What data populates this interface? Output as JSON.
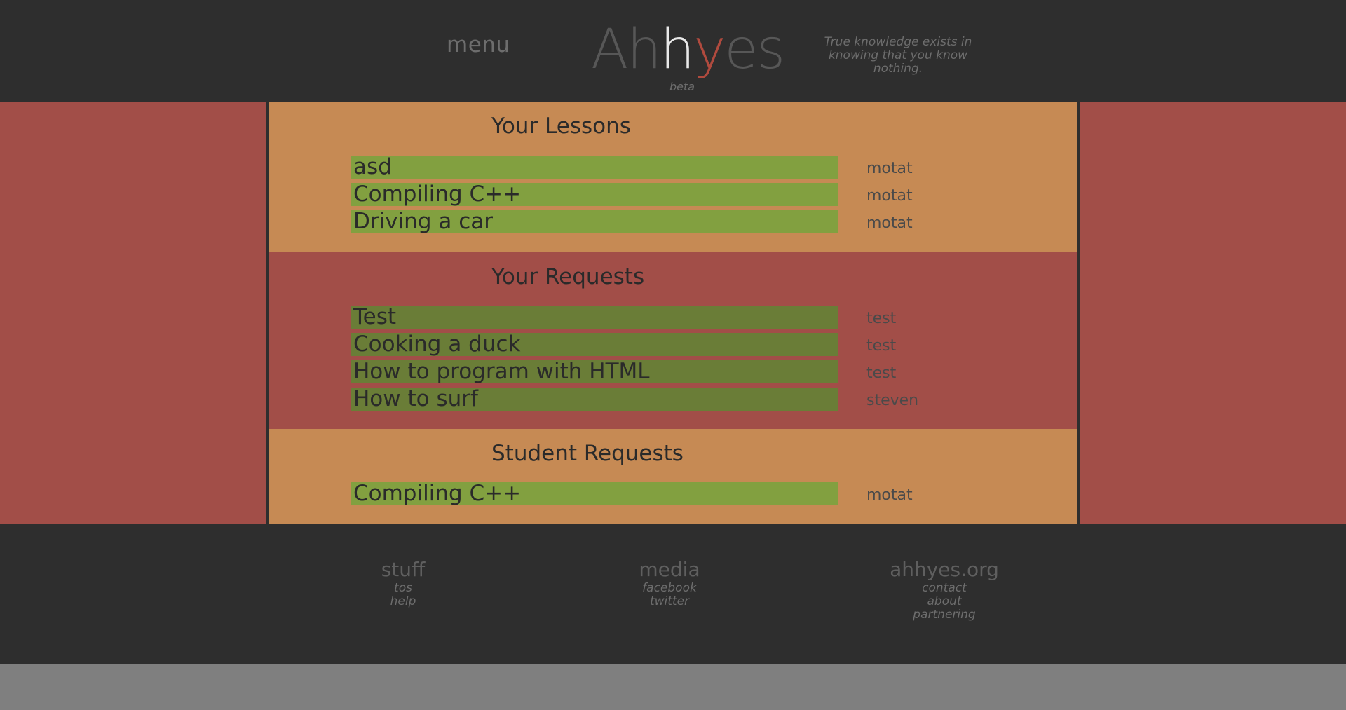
{
  "header": {
    "menu_label": "menu",
    "logo": {
      "part1": "Ah",
      "part2": "h",
      "part3": "y",
      "part4": "es"
    },
    "logo_sub": "beta",
    "quote": "True knowledge exists in knowing that you know nothing."
  },
  "sections": {
    "lessons": {
      "title": "Your Lessons",
      "items": [
        {
          "title": "asd",
          "author": "motat"
        },
        {
          "title": "Compiling C++",
          "author": "motat"
        },
        {
          "title": "Driving a car",
          "author": "motat"
        }
      ]
    },
    "requests": {
      "title": "Your Requests",
      "items": [
        {
          "title": "Test",
          "author": "test"
        },
        {
          "title": "Cooking a duck",
          "author": "test"
        },
        {
          "title": "How to program with HTML",
          "author": "test"
        },
        {
          "title": "How to surf",
          "author": "steven"
        }
      ]
    },
    "student_requests": {
      "title": "Student Requests",
      "items": [
        {
          "title": "Compiling C++",
          "author": "motat"
        }
      ]
    }
  },
  "footer": {
    "stuff": {
      "heading": "stuff",
      "links": [
        "tos",
        "help"
      ]
    },
    "media": {
      "heading": "media",
      "links": [
        "facebook",
        "twitter"
      ]
    },
    "site": {
      "heading": "ahhyes.org",
      "links": [
        "contact",
        "about",
        "partnering"
      ]
    }
  },
  "colors": {
    "header_bg": "#2e2e2e",
    "side_bg": "#a24e48",
    "section_orange": "#c68a54",
    "bar_light_green": "#82a040",
    "bar_dark_green": "#6a7d37",
    "logo_red": "#b04a3e",
    "page_bottom": "#7f7f7f"
  }
}
